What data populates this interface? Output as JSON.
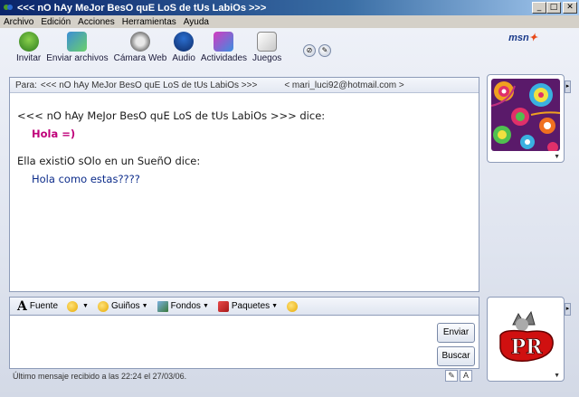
{
  "window": {
    "title": "<<< nO hAy MeJor BesO quE LoS de tUs LabiOs >>>",
    "controls": [
      "_",
      "□",
      "✕"
    ]
  },
  "menu": [
    "Archivo",
    "Edición",
    "Acciones",
    "Herramientas",
    "Ayuda"
  ],
  "toolbar": {
    "items": [
      {
        "label": "Invitar",
        "icon": "invite-icon"
      },
      {
        "label": "Enviar archivos",
        "icon": "send-files-icon"
      },
      {
        "label": "Cámara Web",
        "icon": "webcam-icon"
      },
      {
        "label": "Audio",
        "icon": "audio-icon"
      },
      {
        "label": "Actividades",
        "icon": "activities-icon"
      },
      {
        "label": "Juegos",
        "icon": "games-icon"
      }
    ],
    "logo": "msn"
  },
  "conversation": {
    "to_label": "Para:",
    "to_name": "<<< nO hAy MeJor BesO quE LoS de tUs LabiOs >>>",
    "to_email": "< mari_luci92@hotmail.com >",
    "messages": [
      {
        "sender": "<<< nO hAy MeJor BesO quE LoS de tUs LabiOs >>> dice:",
        "text": "Hola =)"
      },
      {
        "sender": "Ella existiO sOlo en un SueñO dice:",
        "text": "Hola como estas????"
      }
    ]
  },
  "format_bar": {
    "font": "Fuente",
    "winks": "Guiños",
    "backgrounds": "Fondos",
    "packs": "Paquetes"
  },
  "input": {
    "value": "",
    "send_label": "Enviar",
    "search_label": "Buscar"
  },
  "status": {
    "text": "Último mensaje recibido a las 22:24 el 27/03/06."
  },
  "display_pictures": {
    "bottom_text": "PR"
  }
}
